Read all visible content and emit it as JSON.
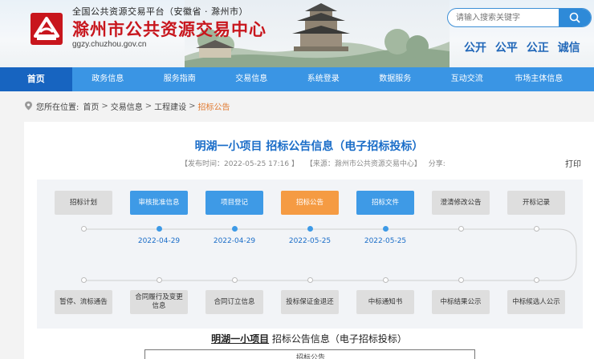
{
  "header": {
    "platform_title": "全国公共资源交易平台（安徽省 · 滁州市）",
    "center_title": "滁州市公共资源交易中心",
    "domain": "ggzy.chuzhou.gov.cn",
    "search_placeholder": "请输入搜索关键字",
    "slogans": [
      "公开",
      "公平",
      "公正",
      "诚信"
    ],
    "brand_color": "#c8161d"
  },
  "nav": {
    "items": [
      "首页",
      "政务信息",
      "服务指南",
      "交易信息",
      "系统登录",
      "数据服务",
      "互动交流",
      "市场主体信息"
    ],
    "active_index": 0,
    "color": "#3a95e4"
  },
  "breadcrumb": {
    "prefix": "您所在位置:",
    "items": [
      "首页",
      "交易信息",
      "工程建设",
      "招标公告"
    ],
    "separator": ">"
  },
  "article": {
    "title": "明湖一小项目 招标公告信息（电子招标投标）",
    "publish_time": "【发布时间：2022-05-25 17:16 】",
    "source": "【来源：滁州市公共资源交易中心】",
    "share": "分享:",
    "print": "打印",
    "body_title_project": "明湖一小项目",
    "body_title_rest": " 招标公告信息（电子招标投标）",
    "doc_head": "招标公告"
  },
  "flow": {
    "top_steps": [
      {
        "label": "招标计划",
        "state": "gray",
        "date": ""
      },
      {
        "label": "审核批准信息",
        "state": "blue",
        "date": "2022-04-29"
      },
      {
        "label": "项目登记",
        "state": "blue",
        "date": "2022-04-29"
      },
      {
        "label": "招标公告",
        "state": "orange",
        "date": "2022-05-25"
      },
      {
        "label": "招标文件",
        "state": "blue",
        "date": "2022-05-25"
      },
      {
        "label": "澄清修改公告",
        "state": "gray",
        "date": ""
      },
      {
        "label": "开标记录",
        "state": "gray",
        "date": ""
      }
    ],
    "bottom_steps": [
      {
        "label": "暂停、流标通告",
        "state": "gray"
      },
      {
        "label": "合同履行及变更信息",
        "state": "gray"
      },
      {
        "label": "合同订立信息",
        "state": "gray"
      },
      {
        "label": "投标保证金退还",
        "state": "gray"
      },
      {
        "label": "中标通知书",
        "state": "gray"
      },
      {
        "label": "中标结果公示",
        "state": "gray"
      },
      {
        "label": "中标候选人公示",
        "state": "gray"
      }
    ]
  }
}
